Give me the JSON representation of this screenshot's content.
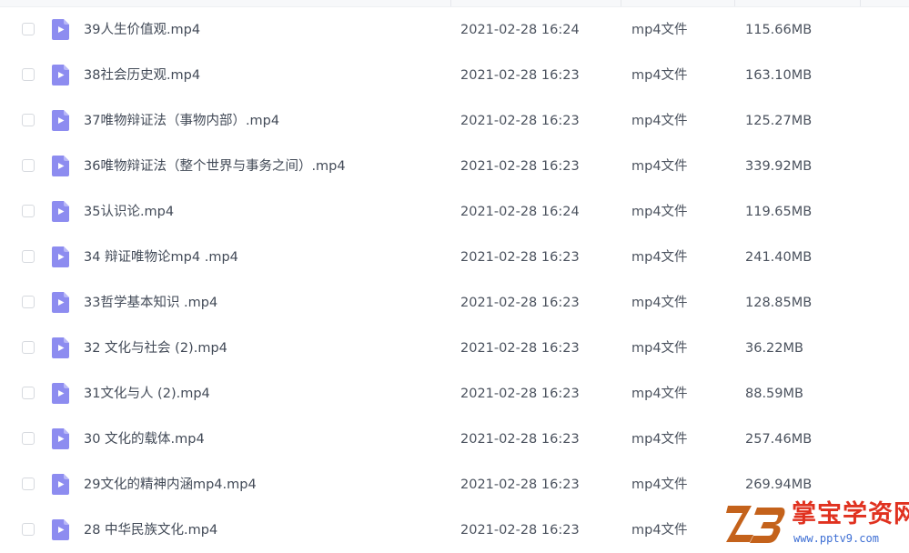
{
  "files": [
    {
      "name": "39人生价值观.mp4",
      "date": "2021-02-28 16:24",
      "type": "mp4文件",
      "size": "115.66MB"
    },
    {
      "name": "38社会历史观.mp4",
      "date": "2021-02-28 16:23",
      "type": "mp4文件",
      "size": "163.10MB"
    },
    {
      "name": "37唯物辩证法（事物内部）.mp4",
      "date": "2021-02-28 16:23",
      "type": "mp4文件",
      "size": "125.27MB"
    },
    {
      "name": "36唯物辩证法（整个世界与事务之间）.mp4",
      "date": "2021-02-28 16:23",
      "type": "mp4文件",
      "size": "339.92MB"
    },
    {
      "name": "35认识论.mp4",
      "date": "2021-02-28 16:24",
      "type": "mp4文件",
      "size": "119.65MB"
    },
    {
      "name": "34 辩证唯物论mp4 .mp4",
      "date": "2021-02-28 16:23",
      "type": "mp4文件",
      "size": "241.40MB"
    },
    {
      "name": "33哲学基本知识 .mp4",
      "date": "2021-02-28 16:23",
      "type": "mp4文件",
      "size": "128.85MB"
    },
    {
      "name": "32 文化与社会 (2).mp4",
      "date": "2021-02-28 16:23",
      "type": "mp4文件",
      "size": "36.22MB"
    },
    {
      "name": "31文化与人 (2).mp4",
      "date": "2021-02-28 16:23",
      "type": "mp4文件",
      "size": "88.59MB"
    },
    {
      "name": "30 文化的载体.mp4",
      "date": "2021-02-28 16:23",
      "type": "mp4文件",
      "size": "257.46MB"
    },
    {
      "name": "29文化的精神内涵mp4.mp4",
      "date": "2021-02-28 16:23",
      "type": "mp4文件",
      "size": "269.94MB"
    },
    {
      "name": "28 中华民族文化.mp4",
      "date": "2021-02-28 16:23",
      "type": "mp4文件",
      "size": ""
    }
  ],
  "icons": {
    "file": "video-file-icon",
    "checkbox": "checkbox-icon"
  },
  "colors": {
    "file_icon": "#8d8cf0",
    "file_icon_fold": "#b9b8f7",
    "text": "#424a57",
    "watermark_red": "#e0311f",
    "watermark_blue": "#3e6fd4"
  },
  "watermark": {
    "logo_text": "Z3",
    "name": "掌宝学资网",
    "url": "www.pptv9.com"
  }
}
